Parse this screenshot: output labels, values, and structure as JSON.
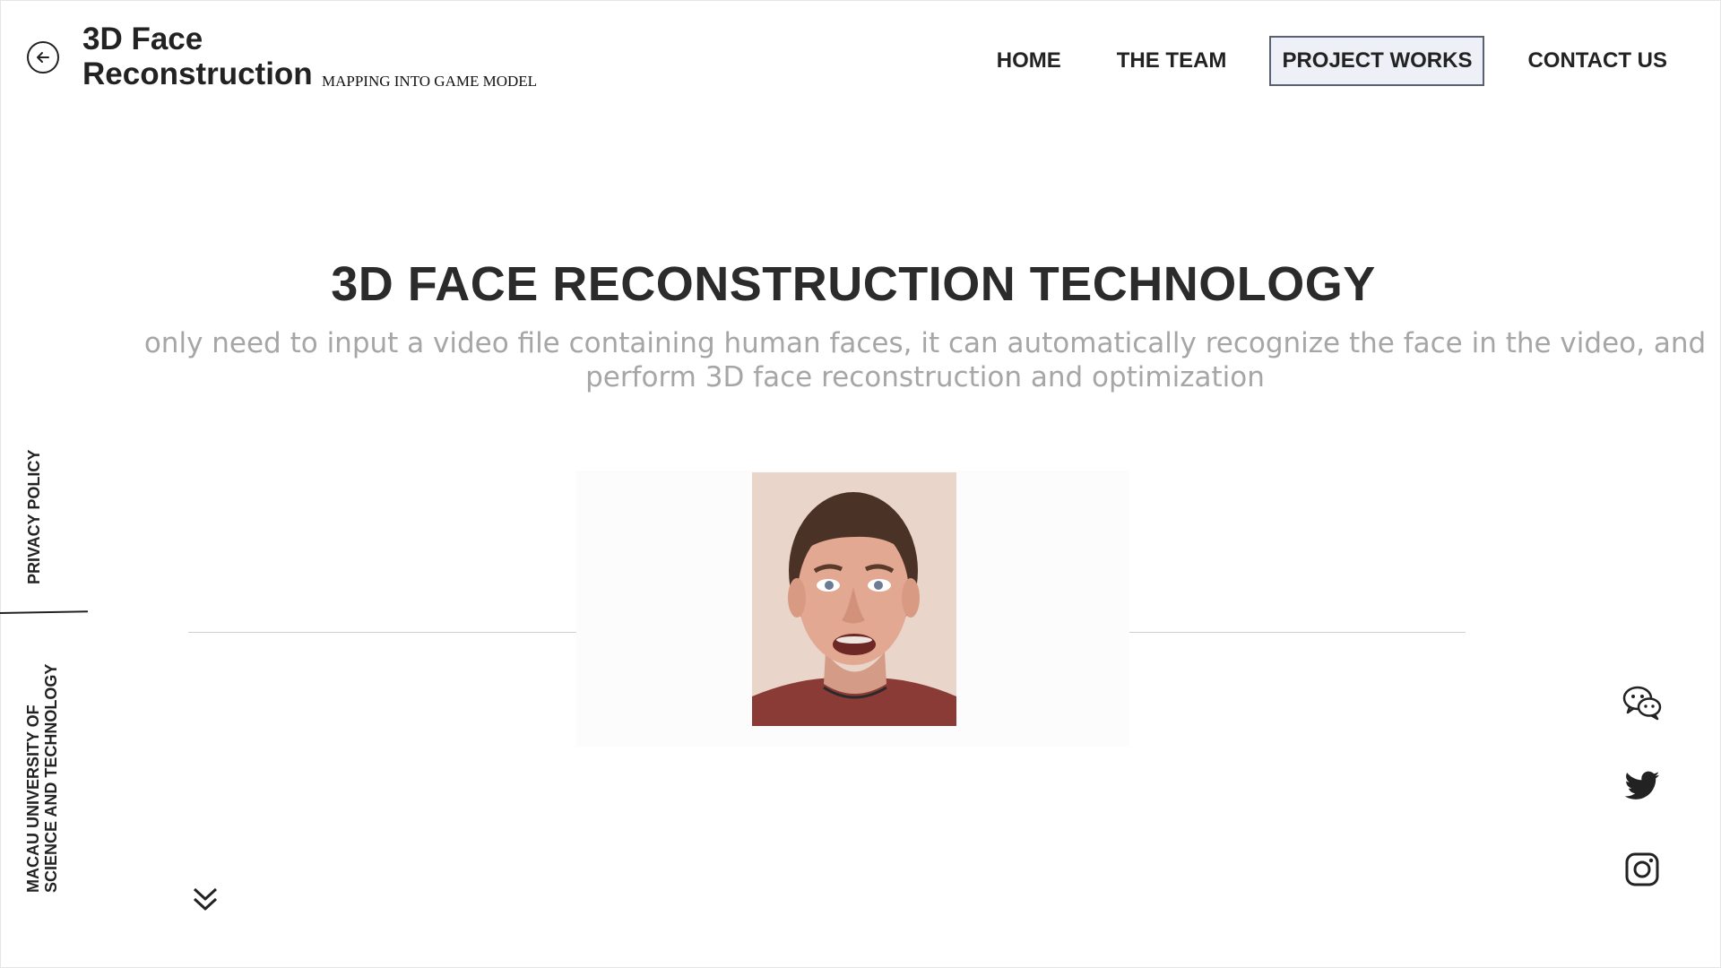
{
  "brand": {
    "title": "3D Face Reconstruction",
    "subtitle": "MAPPING INTO GAME MODEL"
  },
  "nav": {
    "items": [
      {
        "label": "HOME",
        "active": false
      },
      {
        "label": "THE TEAM",
        "active": false
      },
      {
        "label": "PROJECT WORKS",
        "active": true
      },
      {
        "label": "CONTACT US",
        "active": false
      }
    ]
  },
  "hero": {
    "title": "3D FACE RECONSTRUCTION TECHNOLOGY",
    "description": "only need to input a video file containing human faces, it can automatically recognize the face in the video, and perform 3D face reconstruction and optimization"
  },
  "sidebar": {
    "privacy": "PRIVACY POLICY",
    "university_line1": "MACAU UNIVERSITY OF",
    "university_line2": "SCIENCE AND TECHNOLOGY"
  },
  "icons": {
    "back": "arrow-left-circle-icon",
    "scroll_down": "double-chevron-down-icon",
    "social": [
      "wechat-icon",
      "twitter-icon",
      "instagram-icon"
    ]
  },
  "colors": {
    "text": "#222222",
    "muted": "#a6a6a6",
    "active_nav_bg": "#edf0f6",
    "active_nav_border": "#5a6170"
  }
}
